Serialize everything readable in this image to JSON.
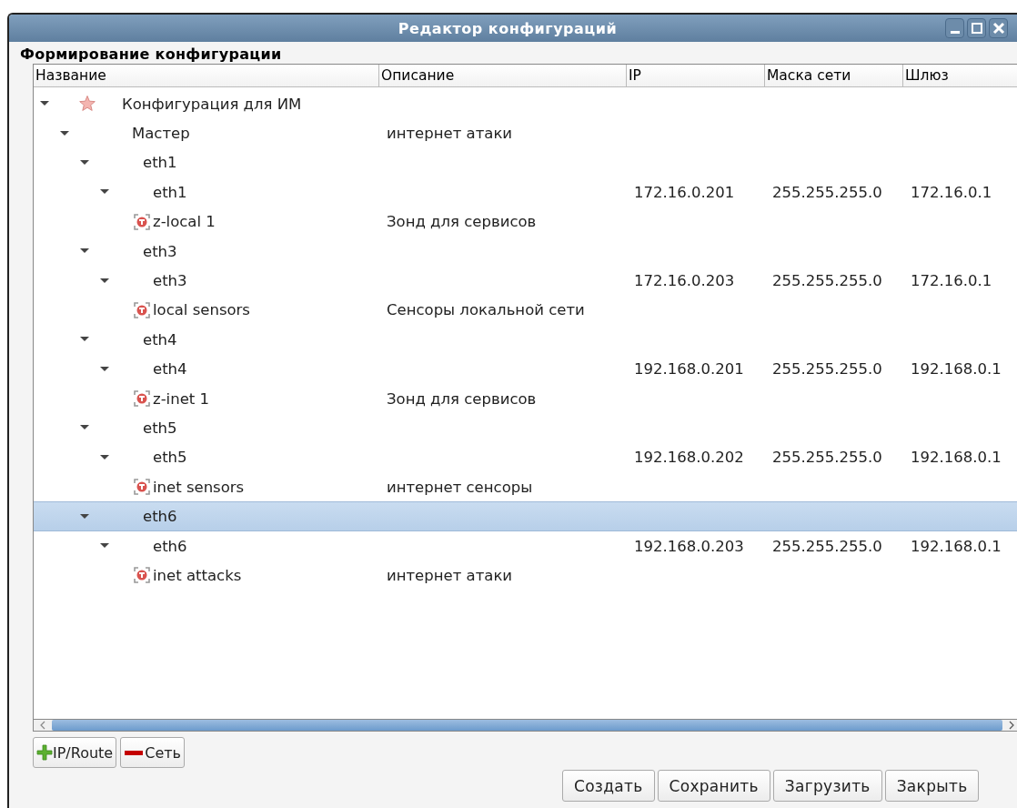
{
  "window": {
    "title": "Редактор конфигураций"
  },
  "section_title": "Формирование конфигурации",
  "table": {
    "columns": [
      "Название",
      "Описание",
      "IP",
      "Маска сети",
      "Шлюз"
    ],
    "rows": [
      {
        "kind": "root",
        "name": "Конфигурация для ИМ",
        "expanded": true,
        "selected": false,
        "children": [
          {
            "name": "Мастер",
            "description": "интернет атаки",
            "expanded": true,
            "selected": false,
            "children": [
              {
                "name": "eth1",
                "expanded": true,
                "selected": false,
                "children": [
                  {
                    "name": "eth1",
                    "ip": "172.16.0.201",
                    "mask": "255.255.255.0",
                    "gateway": "172.16.0.1",
                    "expanded": true,
                    "selected": false,
                    "children": [
                      {
                        "kind": "sensor",
                        "name": "z-local 1",
                        "description": "Зонд для сервисов",
                        "selected": false
                      }
                    ]
                  }
                ]
              },
              {
                "name": "eth3",
                "expanded": true,
                "selected": false,
                "children": [
                  {
                    "name": "eth3",
                    "ip": "172.16.0.203",
                    "mask": "255.255.255.0",
                    "gateway": "172.16.0.1",
                    "expanded": true,
                    "selected": false,
                    "children": [
                      {
                        "kind": "sensor",
                        "name": "local sensors",
                        "description": "Сенсоры локальной сети",
                        "selected": false
                      }
                    ]
                  }
                ]
              },
              {
                "name": "eth4",
                "expanded": true,
                "selected": false,
                "children": [
                  {
                    "name": "eth4",
                    "ip": "192.168.0.201",
                    "mask": "255.255.255.0",
                    "gateway": "192.168.0.1",
                    "expanded": true,
                    "selected": false,
                    "children": [
                      {
                        "kind": "sensor",
                        "name": "z-inet 1",
                        "description": "Зонд для сервисов",
                        "selected": false
                      }
                    ]
                  }
                ]
              },
              {
                "name": "eth5",
                "expanded": true,
                "selected": false,
                "children": [
                  {
                    "name": "eth5",
                    "ip": "192.168.0.202",
                    "mask": "255.255.255.0",
                    "gateway": "192.168.0.1",
                    "expanded": true,
                    "selected": false,
                    "children": [
                      {
                        "kind": "sensor",
                        "name": "inet sensors",
                        "description": "интернет сенсоры",
                        "selected": false
                      }
                    ]
                  }
                ]
              },
              {
                "name": "eth6",
                "expanded": true,
                "selected": true,
                "children": [
                  {
                    "name": "eth6",
                    "ip": "192.168.0.203",
                    "mask": "255.255.255.0",
                    "gateway": "192.168.0.1",
                    "expanded": true,
                    "selected": false,
                    "children": [
                      {
                        "kind": "sensor",
                        "name": "inet attacks",
                        "description": "интернет атаки",
                        "selected": false
                      }
                    ]
                  }
                ]
              }
            ]
          }
        ]
      }
    ]
  },
  "tree_buttons": [
    {
      "kind": "add",
      "label": "IP/Route"
    },
    {
      "kind": "remove",
      "label": "Сеть"
    }
  ],
  "buttons": [
    "Создать",
    "Сохранить",
    "Загрузить",
    "Закрыть"
  ]
}
